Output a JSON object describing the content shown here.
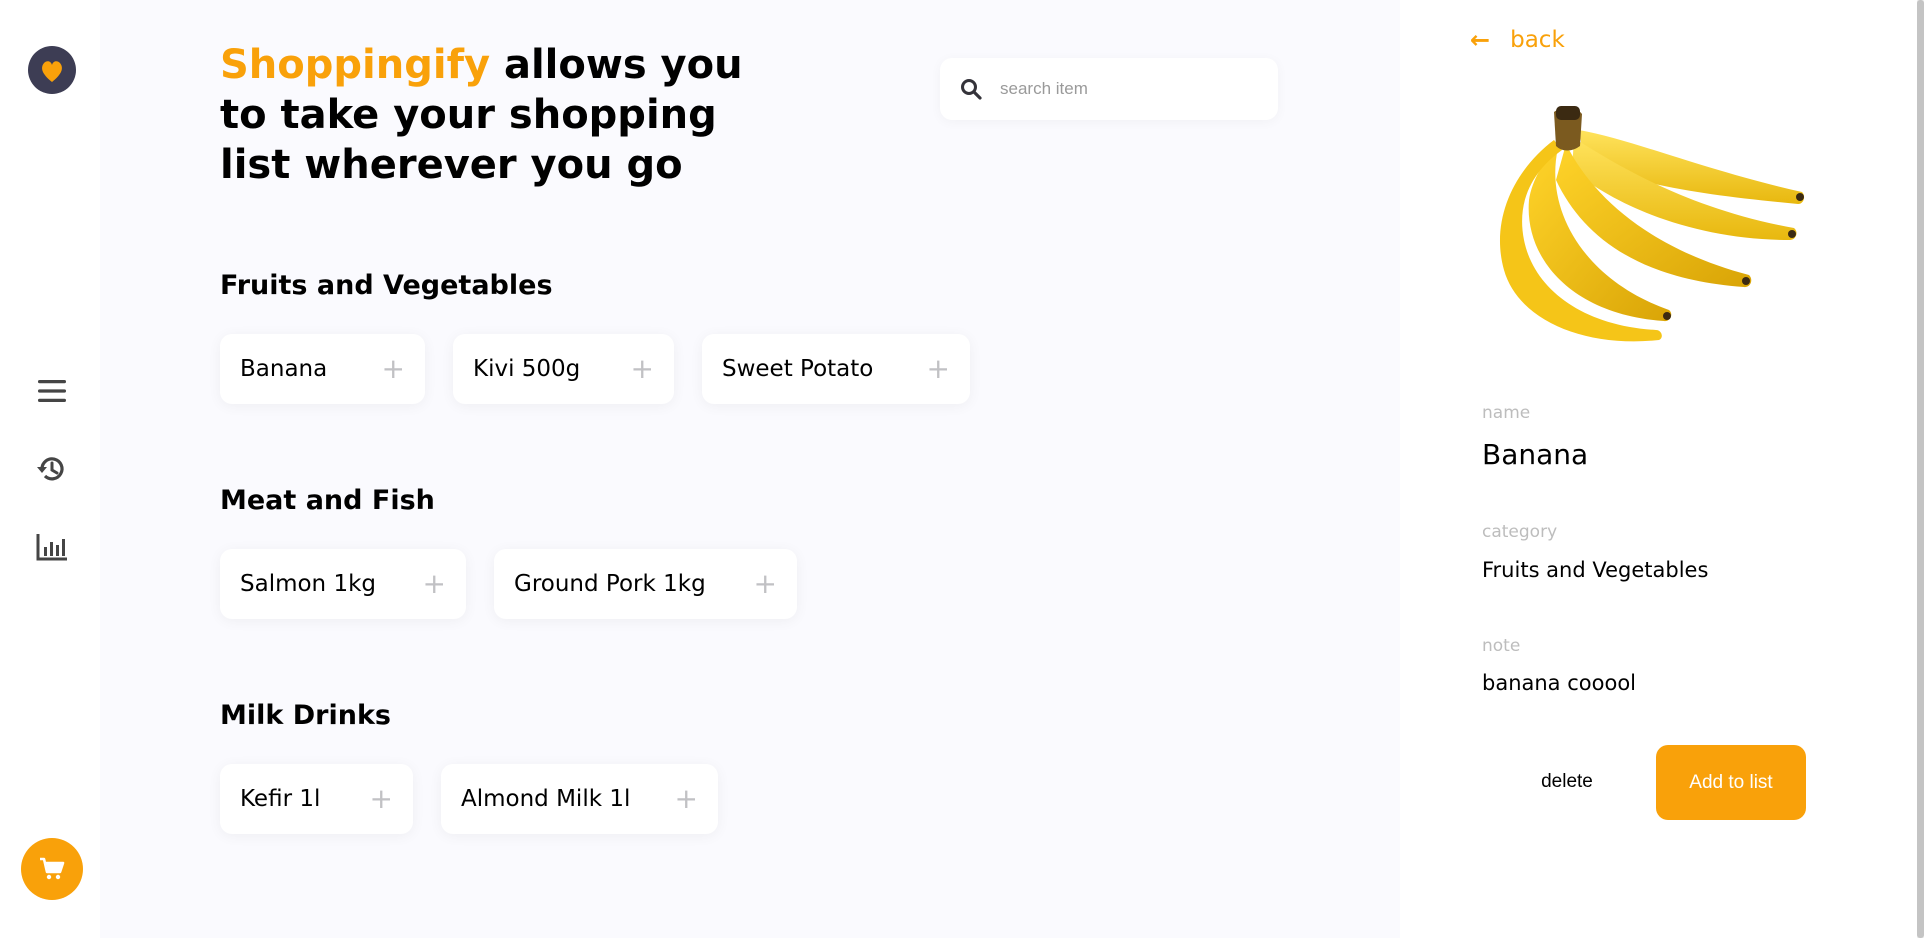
{
  "app": {
    "brand": "Shoppingify",
    "tagline_rest": " allows you to take your shopping list wherever you go"
  },
  "colors": {
    "accent": "#f9a10a",
    "logo_bg": "#3d3d54",
    "main_bg": "#fafafe"
  },
  "sidebar": {
    "icons": [
      "logo-icon",
      "list-icon",
      "history-icon",
      "statistics-icon",
      "cart-icon"
    ]
  },
  "search": {
    "placeholder": "search item",
    "value": ""
  },
  "categories": [
    {
      "title": "Fruits and Vegetables",
      "items": [
        "Banana",
        "Kivi 500g",
        "Sweet Potato"
      ]
    },
    {
      "title": "Meat and Fish",
      "items": [
        "Salmon 1kg",
        "Ground Pork 1kg"
      ]
    },
    {
      "title": "Milk Drinks",
      "items": [
        "Kefir 1l",
        "Almond Milk 1l"
      ]
    }
  ],
  "detail": {
    "back_label": "back",
    "name_label": "name",
    "name_value": "Banana",
    "category_label": "category",
    "category_value": "Fruits and Vegetables",
    "note_label": "note",
    "note_value": "banana cooool",
    "delete_label": "delete",
    "add_label": "Add to list"
  }
}
